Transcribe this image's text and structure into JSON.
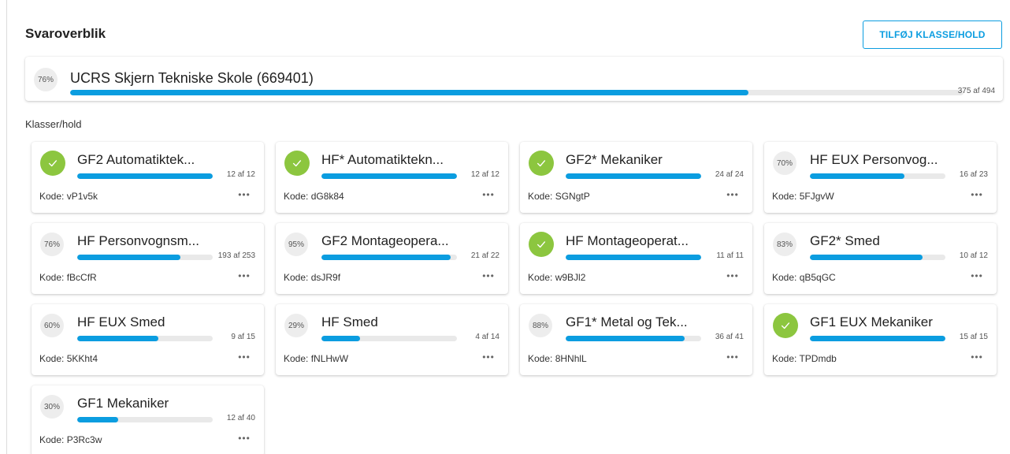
{
  "header": {
    "title": "Svaroverblik",
    "add_button_label": "TILFØJ KLASSE/HOLD"
  },
  "school": {
    "percent_label": "76%",
    "name": "UCRS Skjern Tekniske Skole (669401)",
    "count_label": "375 af 494",
    "answered": 375,
    "total": 494
  },
  "section_label": "Klasser/hold",
  "classes": [
    {
      "name": "GF2 Automatiktek...",
      "percent_label": "",
      "complete": true,
      "answered": 12,
      "total": 12,
      "count_label": "12 af 12",
      "code_label": "Kode: vP1v5k"
    },
    {
      "name": "HF* Automatiktekn...",
      "percent_label": "",
      "complete": true,
      "answered": 12,
      "total": 12,
      "count_label": "12 af 12",
      "code_label": "Kode: dG8k84"
    },
    {
      "name": "GF2* Mekaniker",
      "percent_label": "",
      "complete": true,
      "answered": 24,
      "total": 24,
      "count_label": "24 af 24",
      "code_label": "Kode: SGNgtP"
    },
    {
      "name": "HF EUX Personvog...",
      "percent_label": "70%",
      "complete": false,
      "answered": 16,
      "total": 23,
      "count_label": "16 af 23",
      "code_label": "Kode: 5FJgvW"
    },
    {
      "name": "HF Personvognsm...",
      "percent_label": "76%",
      "complete": false,
      "answered": 193,
      "total": 253,
      "count_label": "193 af 253",
      "code_label": "Kode: fBcCfR"
    },
    {
      "name": "GF2 Montageopera...",
      "percent_label": "95%",
      "complete": false,
      "answered": 21,
      "total": 22,
      "count_label": "21 af 22",
      "code_label": "Kode: dsJR9f"
    },
    {
      "name": "HF Montageoperat...",
      "percent_label": "",
      "complete": true,
      "answered": 11,
      "total": 11,
      "count_label": "11 af 11",
      "code_label": "Kode: w9BJl2"
    },
    {
      "name": "GF2* Smed",
      "percent_label": "83%",
      "complete": false,
      "answered": 10,
      "total": 12,
      "count_label": "10 af 12",
      "code_label": "Kode: qB5qGC"
    },
    {
      "name": "HF EUX Smed",
      "percent_label": "60%",
      "complete": false,
      "answered": 9,
      "total": 15,
      "count_label": "9 af 15",
      "code_label": "Kode: 5KKht4"
    },
    {
      "name": "HF Smed",
      "percent_label": "29%",
      "complete": false,
      "answered": 4,
      "total": 14,
      "count_label": "4 af 14",
      "code_label": "Kode: fNLHwW"
    },
    {
      "name": "GF1* Metal og Tek...",
      "percent_label": "88%",
      "complete": false,
      "answered": 36,
      "total": 41,
      "count_label": "36 af 41",
      "code_label": "Kode: 8HNhlL"
    },
    {
      "name": "GF1 EUX Mekaniker",
      "percent_label": "",
      "complete": true,
      "answered": 15,
      "total": 15,
      "count_label": "15 af 15",
      "code_label": "Kode: TPDmdb"
    },
    {
      "name": "GF1 Mekaniker",
      "percent_label": "30%",
      "complete": false,
      "answered": 12,
      "total": 40,
      "count_label": "12 af 40",
      "code_label": "Kode: P3Rc3w"
    }
  ],
  "more_label": "•••",
  "colors": {
    "accent": "#0b9de0",
    "complete": "#8cc63f",
    "track": "#e9e9e9"
  }
}
